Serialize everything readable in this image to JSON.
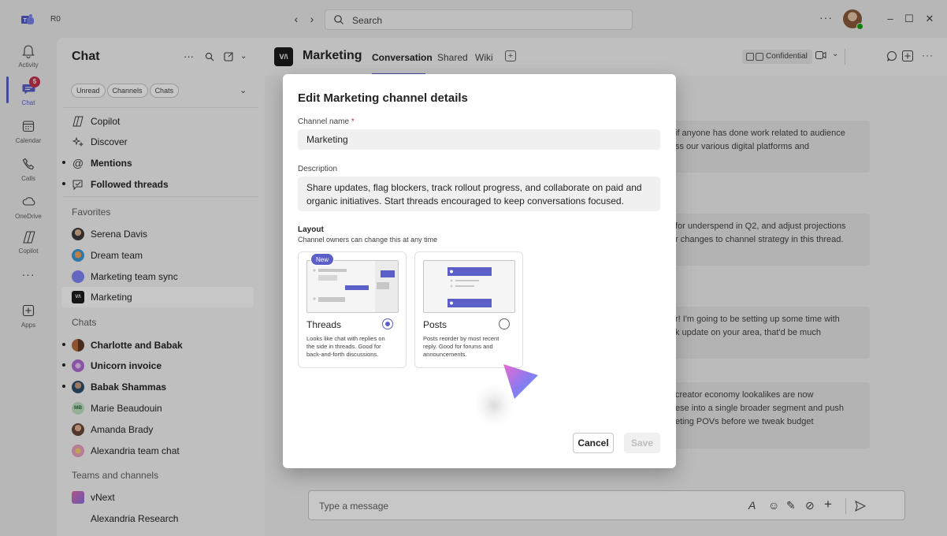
{
  "titlebar": {
    "org": "R0",
    "search_placeholder": "Search"
  },
  "rail": {
    "items": [
      {
        "label": "Activity",
        "icon": "bell-icon"
      },
      {
        "label": "Chat",
        "icon": "chat-icon",
        "badge": "5"
      },
      {
        "label": "Calendar",
        "icon": "calendar-icon"
      },
      {
        "label": "Calls",
        "icon": "phone-icon"
      },
      {
        "label": "OneDrive",
        "icon": "cloud-icon"
      },
      {
        "label": "Copilot",
        "icon": "copilot-icon"
      },
      {
        "label": "",
        "icon": "more-icon"
      },
      {
        "label": "Apps",
        "icon": "apps-plus-icon"
      }
    ]
  },
  "chat_pane": {
    "title": "Chat",
    "filters": [
      "Unread",
      "Channels",
      "Chats"
    ],
    "top_items": [
      {
        "label": "Copilot",
        "bold": false,
        "dot": false
      },
      {
        "label": "Discover",
        "bold": false,
        "dot": false
      },
      {
        "label": "Mentions",
        "bold": true,
        "dot": true
      },
      {
        "label": "Followed threads",
        "bold": true,
        "dot": true
      }
    ],
    "favorites_header": "Favorites",
    "favorites": [
      {
        "label": "Serena Davis",
        "bold": false,
        "dot": false
      },
      {
        "label": "Dream team",
        "bold": false,
        "dot": false
      },
      {
        "label": "Marketing team sync",
        "bold": false,
        "dot": false
      },
      {
        "label": "Marketing",
        "bold": false,
        "dot": false,
        "active": true
      }
    ],
    "chats_header": "Chats",
    "chats": [
      {
        "label": "Charlotte and Babak",
        "bold": true,
        "dot": true
      },
      {
        "label": "Unicorn invoice",
        "bold": true,
        "dot": true
      },
      {
        "label": "Babak Shammas",
        "bold": true,
        "dot": true
      },
      {
        "label": "Marie Beaudouin",
        "bold": false,
        "dot": false,
        "initials": "MB"
      },
      {
        "label": "Amanda Brady",
        "bold": false,
        "dot": false
      },
      {
        "label": "Alexandria team chat",
        "bold": false,
        "dot": false
      }
    ],
    "teams_header": "Teams and channels",
    "teams": [
      {
        "label": "vNext"
      },
      {
        "label": "Alexandria Research"
      }
    ]
  },
  "channel": {
    "logo_text": "V/\\",
    "name": "Marketing",
    "tabs": [
      "Conversation",
      "Shared",
      "Wiki"
    ],
    "active_tab": "Conversation",
    "confidential_label": "Confidential"
  },
  "messages": [
    {
      "lines": [
        "if anyone has done work related to audience",
        "ss our various digital platforms and"
      ]
    },
    {
      "lines": [
        "for underspend in Q2, and adjust projections",
        "r changes to channel strategy in this thread."
      ]
    },
    {
      "lines": [
        "r! I'm going to be setting up some time with",
        "k update on your area, that'd be much"
      ]
    },
    {
      "lines": [
        "creator economy lookalikes are now",
        "ese into a single broader segment and push",
        "eting POVs before we tweak budget"
      ]
    }
  ],
  "compose": {
    "placeholder": "Type a message"
  },
  "dialog": {
    "title": "Edit Marketing channel details",
    "name_label": "Channel name",
    "required_mark": "*",
    "name_value": "Marketing",
    "description_label": "Description",
    "description_lines": [
      "Share updates, flag blockers, track rollout progress, and collaborate on paid and",
      "organic initiatives. Start threads encouraged to keep conversations focused."
    ],
    "layout_title": "Layout",
    "layout_subtitle": "Channel owners can change this at any time",
    "options": [
      {
        "title": "Threads",
        "badge": "New",
        "selected": true,
        "desc_lines": [
          "Looks like chat with replies on",
          "the side in threads. Good for",
          "back-and-forth discussions."
        ]
      },
      {
        "title": "Posts",
        "selected": false,
        "desc_lines": [
          "Posts reorder by most recent",
          "reply. Good for forums and",
          "announcements."
        ]
      }
    ],
    "cancel_label": "Cancel",
    "save_label": "Save"
  },
  "colors": {
    "accent": "#5b5fc7",
    "badge_red": "#c4314b",
    "presence_green": "#13a10e"
  }
}
